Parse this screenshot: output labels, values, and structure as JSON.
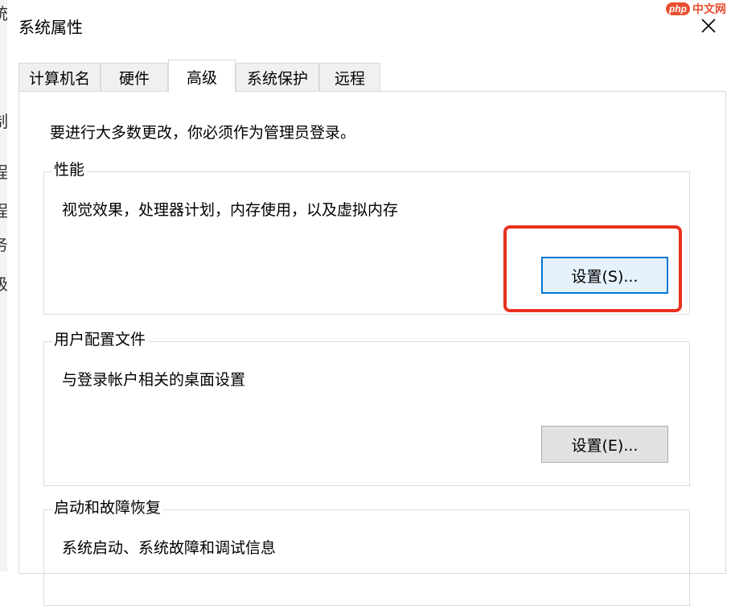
{
  "background_window": {
    "glyphs": [
      "统",
      "制",
      "程",
      "程",
      "务",
      "级"
    ]
  },
  "watermark": {
    "logo": "php",
    "text": "中文网"
  },
  "window": {
    "title": "系统属性"
  },
  "tabs": [
    {
      "label": "计算机名"
    },
    {
      "label": "硬件"
    },
    {
      "label": "高级",
      "active": true
    },
    {
      "label": "系统保护"
    },
    {
      "label": "远程"
    }
  ],
  "notice": "要进行大多数更改，你必须作为管理员登录。",
  "groups": {
    "performance": {
      "title": "性能",
      "description": "视觉效果，处理器计划，内存使用，以及虚拟内存",
      "button": "设置(S)..."
    },
    "user_profiles": {
      "title": "用户配置文件",
      "description": "与登录帐户相关的桌面设置",
      "button": "设置(E)..."
    },
    "startup_recovery": {
      "title": "启动和故障恢复",
      "description": "系统启动、系统故障和调试信息"
    }
  },
  "colors": {
    "accent": "#0078d7",
    "highlight": "#e8321e"
  }
}
